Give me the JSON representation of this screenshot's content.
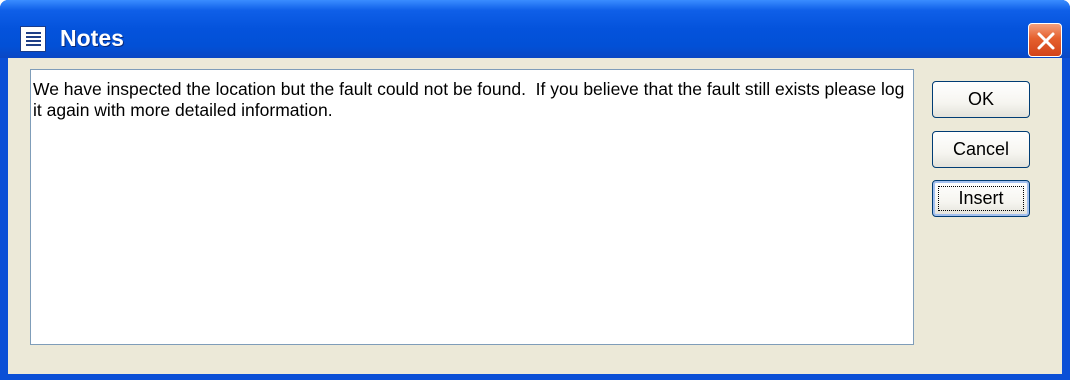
{
  "window": {
    "title": "Notes",
    "icon": "notes-window-icon",
    "close_icon": "close-icon"
  },
  "notes": {
    "text": "We have inspected the location but the fault could not be found.  If you believe that the fault still exists please log it again with more detailed information."
  },
  "buttons": {
    "ok_label": "OK",
    "cancel_label": "Cancel",
    "insert_label": "Insert"
  }
}
